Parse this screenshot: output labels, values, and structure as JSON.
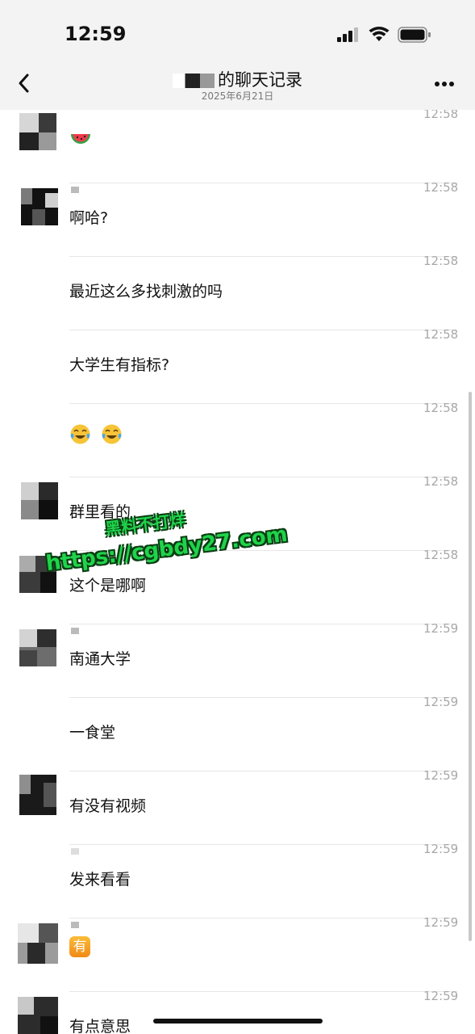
{
  "status_bar": {
    "time": "12:59"
  },
  "nav": {
    "title": "的聊天记录",
    "subtitle": "2025年6月21日",
    "back_icon": "chevron-left-icon",
    "more_icon": "ellipsis-icon"
  },
  "messages": [
    {
      "time": "12:58",
      "text": "",
      "emoji": [
        "watermelon"
      ],
      "has_avatar": true
    },
    {
      "time": "12:58",
      "text": "啊哈?",
      "has_avatar": true
    },
    {
      "time": "12:58",
      "text": "最近这么多找刺激的吗",
      "has_avatar": false
    },
    {
      "time": "12:58",
      "text": "大学生有指标?",
      "has_avatar": false
    },
    {
      "time": "12:58",
      "text": "",
      "emoji": [
        "tears-of-joy",
        "tears-of-joy"
      ],
      "has_avatar": false
    },
    {
      "time": "12:58",
      "text": "群里看的",
      "has_avatar": true
    },
    {
      "time": "12:58",
      "text": "这个是哪啊",
      "has_avatar": true
    },
    {
      "time": "12:59",
      "text": "南通大学",
      "has_avatar": true
    },
    {
      "time": "12:59",
      "text": "一食堂",
      "has_avatar": false
    },
    {
      "time": "12:59",
      "text": "有没有视频",
      "has_avatar": true
    },
    {
      "time": "12:59",
      "text": "发来看看",
      "has_avatar": false
    },
    {
      "time": "12:59",
      "text": "",
      "badge": "有",
      "has_avatar": true
    },
    {
      "time": "12:59",
      "text": "有点意思",
      "has_avatar": true
    }
  ],
  "watermark": {
    "line1": "黑料不打烊",
    "line2": "https://cgbdy27.com"
  }
}
